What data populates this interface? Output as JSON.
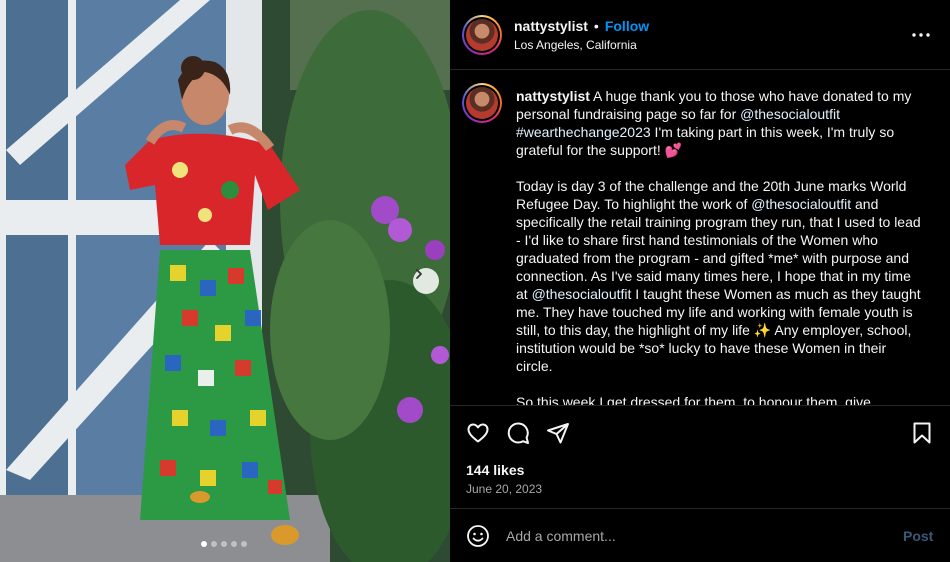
{
  "post": {
    "username": "nattystylist",
    "bullet": "•",
    "follow_label": "Follow",
    "location": "Los Angeles, California",
    "more_icon": "more-horizontal-icon"
  },
  "caption": {
    "username": "nattystylist",
    "p1_a": " A huge thank you to those who have donated to my personal fundraising page so far for ",
    "p1_mention": "@thesocialoutfit",
    "p1_hashtag": "#wearthechange2023",
    "p1_b": " I'm taking part in this week, I'm truly so grateful for the support! 💕",
    "p2_a": "Today is day 3 of the challenge and the 20th June marks World Refugee Day. To highlight the work of ",
    "p2_mention1": "@thesocialoutfit",
    "p2_b": " and specifically the retail training program they run, that I used to lead - I'd like to share first hand testimonials of the Women who graduated from the program - and gifted *me* with purpose and connection. As I've said many times here, I hope that in my time at ",
    "p2_mention2": "@thesocialoutfit",
    "p2_c": " I taught these Women as much as they taught me. They have touched my life and working with female youth is still, to this day, the highlight of my life ✨ Any employer, school, institution would be *so* lucky to have these Women in their circle.",
    "p3": "So this week I get dressed for them, to honour them, give"
  },
  "photo": {
    "next_icon": "chevron-right-icon",
    "carousel_count": 5,
    "carousel_active": 0
  },
  "actions": {
    "like_icon": "heart-icon",
    "comment_icon": "comment-icon",
    "share_icon": "share-icon",
    "save_icon": "bookmark-icon",
    "likes_text": "144 likes",
    "date_text": "June 20, 2023"
  },
  "comment": {
    "emoji_icon": "emoji-icon",
    "placeholder": "Add a comment...",
    "post_label": "Post"
  },
  "colors": {
    "accent": "#0095f6",
    "mention": "#e0f1ff",
    "muted": "#a8a8a8",
    "post_disabled": "#3b5878"
  }
}
